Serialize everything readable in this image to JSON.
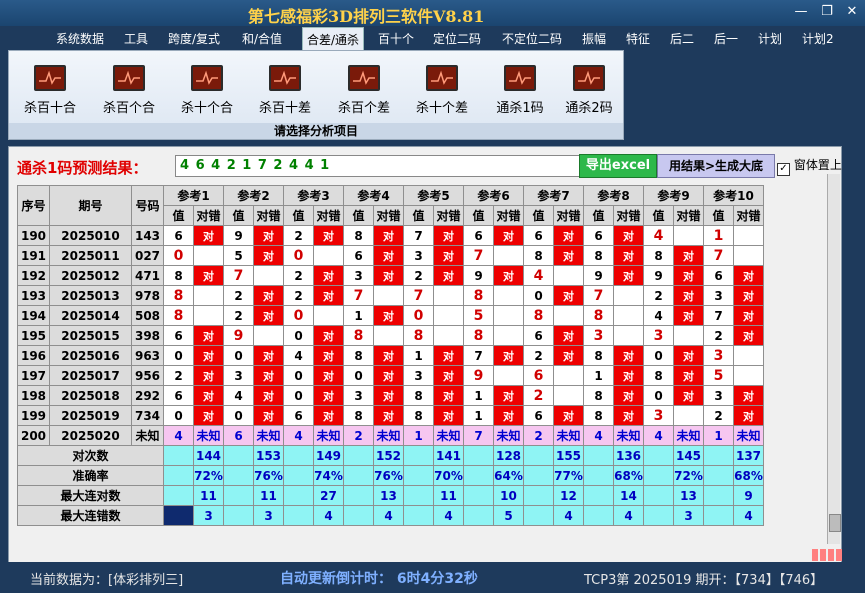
{
  "window": {
    "title": "第七感福彩3D排列三软件V8.81",
    "min": "—",
    "restore": "❐",
    "close": "✕"
  },
  "menu": [
    "系统数据",
    "工具",
    "跨度/复式",
    "和/合值",
    "合差/通杀",
    "百十个",
    "定位二码",
    "不定位二码",
    "振幅",
    "特征",
    "后二",
    "后一",
    "计划",
    "计划2"
  ],
  "menu_active": "合差/通杀",
  "ribbon": {
    "buttons": [
      "杀百十合",
      "杀百个合",
      "杀十个合",
      "杀百十差",
      "杀百个差",
      "杀十个差",
      "通杀1码",
      "通杀2码"
    ],
    "footer": "请选择分析项目"
  },
  "result": {
    "label": "通杀1码预测结果：",
    "value": "4 6 4 2 1 7 2 4 4 1",
    "export_btn": "导出excel",
    "gen_btn": "用结果>生成大底",
    "topmost_label": "窗体置上",
    "topmost_checked": "✓"
  },
  "grid": {
    "h_seq": "序号",
    "h_period": "期号",
    "h_code": "号码",
    "refs": [
      "参考1",
      "参考2",
      "参考3",
      "参考4",
      "参考5",
      "参考6",
      "参考7",
      "参考8",
      "参考9",
      "参考10"
    ],
    "sub_val": "值",
    "sub_chk": "对错",
    "rows": [
      {
        "seq": "190",
        "period": "2025010",
        "code": "143",
        "cells": [
          [
            "6",
            "对"
          ],
          [
            "9",
            "对"
          ],
          [
            "2",
            "对"
          ],
          [
            "8",
            "对"
          ],
          [
            "7",
            "对"
          ],
          [
            "6",
            "对"
          ],
          [
            "6",
            "对"
          ],
          [
            "6",
            "对"
          ],
          [
            "4",
            ""
          ],
          [
            "1",
            ""
          ]
        ]
      },
      {
        "seq": "191",
        "period": "2025011",
        "code": "027",
        "cells": [
          [
            "0",
            ""
          ],
          [
            "5",
            "对"
          ],
          [
            "0",
            ""
          ],
          [
            "6",
            "对"
          ],
          [
            "3",
            "对"
          ],
          [
            "7",
            ""
          ],
          [
            "8",
            "对"
          ],
          [
            "8",
            "对"
          ],
          [
            "8",
            "对"
          ],
          [
            "7",
            ""
          ]
        ]
      },
      {
        "seq": "192",
        "period": "2025012",
        "code": "471",
        "cells": [
          [
            "8",
            "对"
          ],
          [
            "7",
            ""
          ],
          [
            "2",
            "对"
          ],
          [
            "3",
            "对"
          ],
          [
            "2",
            "对"
          ],
          [
            "9",
            "对"
          ],
          [
            "4",
            ""
          ],
          [
            "9",
            "对"
          ],
          [
            "9",
            "对"
          ],
          [
            "6",
            "对"
          ]
        ]
      },
      {
        "seq": "193",
        "period": "2025013",
        "code": "978",
        "cells": [
          [
            "8",
            ""
          ],
          [
            "2",
            "对"
          ],
          [
            "2",
            "对"
          ],
          [
            "7",
            ""
          ],
          [
            "7",
            ""
          ],
          [
            "8",
            ""
          ],
          [
            "0",
            "对"
          ],
          [
            "7",
            ""
          ],
          [
            "2",
            "对"
          ],
          [
            "3",
            "对"
          ]
        ]
      },
      {
        "seq": "194",
        "period": "2025014",
        "code": "508",
        "cells": [
          [
            "8",
            ""
          ],
          [
            "2",
            "对"
          ],
          [
            "0",
            ""
          ],
          [
            "1",
            "对"
          ],
          [
            "0",
            ""
          ],
          [
            "5",
            ""
          ],
          [
            "8",
            ""
          ],
          [
            "8",
            ""
          ],
          [
            "4",
            "对"
          ],
          [
            "7",
            "对"
          ]
        ]
      },
      {
        "seq": "195",
        "period": "2025015",
        "code": "398",
        "cells": [
          [
            "6",
            "对"
          ],
          [
            "9",
            ""
          ],
          [
            "0",
            "对"
          ],
          [
            "8",
            ""
          ],
          [
            "8",
            ""
          ],
          [
            "8",
            ""
          ],
          [
            "6",
            "对"
          ],
          [
            "3",
            ""
          ],
          [
            "3",
            ""
          ],
          [
            "2",
            "对"
          ]
        ]
      },
      {
        "seq": "196",
        "period": "2025016",
        "code": "963",
        "cells": [
          [
            "0",
            "对"
          ],
          [
            "0",
            "对"
          ],
          [
            "4",
            "对"
          ],
          [
            "8",
            "对"
          ],
          [
            "1",
            "对"
          ],
          [
            "7",
            "对"
          ],
          [
            "2",
            "对"
          ],
          [
            "8",
            "对"
          ],
          [
            "0",
            "对"
          ],
          [
            "3",
            ""
          ]
        ]
      },
      {
        "seq": "197",
        "period": "2025017",
        "code": "956",
        "cells": [
          [
            "2",
            "对"
          ],
          [
            "3",
            "对"
          ],
          [
            "0",
            "对"
          ],
          [
            "0",
            "对"
          ],
          [
            "3",
            "对"
          ],
          [
            "9",
            ""
          ],
          [
            "6",
            ""
          ],
          [
            "1",
            "对"
          ],
          [
            "8",
            "对"
          ],
          [
            "5",
            ""
          ]
        ]
      },
      {
        "seq": "198",
        "period": "2025018",
        "code": "292",
        "cells": [
          [
            "6",
            "对"
          ],
          [
            "4",
            "对"
          ],
          [
            "0",
            "对"
          ],
          [
            "3",
            "对"
          ],
          [
            "8",
            "对"
          ],
          [
            "1",
            "对"
          ],
          [
            "2",
            ""
          ],
          [
            "8",
            "对"
          ],
          [
            "0",
            "对"
          ],
          [
            "3",
            "对"
          ]
        ]
      },
      {
        "seq": "199",
        "period": "2025019",
        "code": "734",
        "cells": [
          [
            "0",
            "对"
          ],
          [
            "0",
            "对"
          ],
          [
            "6",
            "对"
          ],
          [
            "8",
            "对"
          ],
          [
            "8",
            "对"
          ],
          [
            "1",
            "对"
          ],
          [
            "6",
            "对"
          ],
          [
            "8",
            "对"
          ],
          [
            "3",
            ""
          ],
          [
            "2",
            "对"
          ]
        ]
      }
    ],
    "predict": {
      "seq": "200",
      "period": "2025020",
      "code": "未知",
      "vals": [
        "4",
        "6",
        "4",
        "2",
        "1",
        "7",
        "2",
        "4",
        "4",
        "1"
      ],
      "chk": "未知"
    },
    "stats": [
      {
        "label": "对次数",
        "values": [
          "144",
          "153",
          "149",
          "152",
          "141",
          "128",
          "155",
          "136",
          "145",
          "137"
        ]
      },
      {
        "label": "准确率",
        "values": [
          "72%",
          "76%",
          "74%",
          "76%",
          "70%",
          "64%",
          "77%",
          "68%",
          "72%",
          "68%"
        ]
      },
      {
        "label": "最大连对数",
        "values": [
          "11",
          "11",
          "27",
          "13",
          "11",
          "10",
          "12",
          "14",
          "13",
          "9"
        ]
      },
      {
        "label": "最大连错数",
        "values": [
          "3",
          "3",
          "4",
          "4",
          "4",
          "5",
          "4",
          "4",
          "3",
          "4"
        ]
      }
    ]
  },
  "status": {
    "current": "当前数据为：[体彩排列三]",
    "countdown": "自动更新倒计时： 6时4分32秒",
    "draw": "TCP3第 2025019 期开：【734】【746】"
  }
}
